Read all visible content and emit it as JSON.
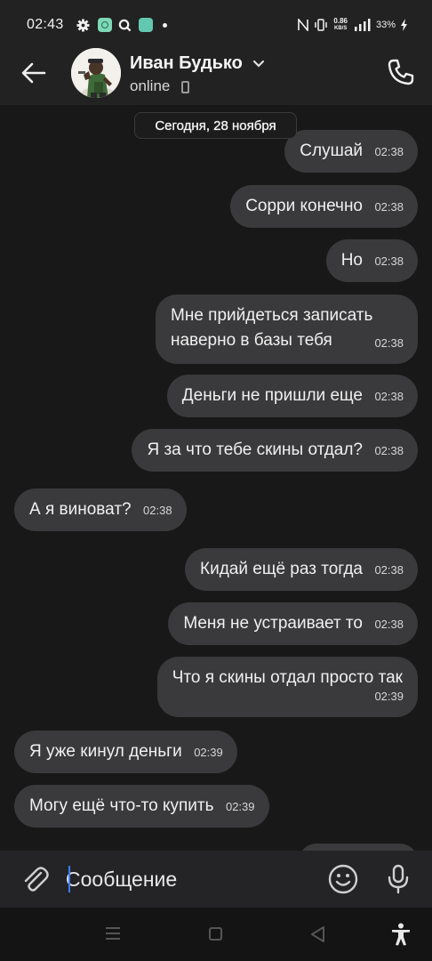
{
  "status_bar": {
    "time": "02:43",
    "speed_value": "0.86",
    "speed_unit": "KB/S",
    "battery": "33%"
  },
  "header": {
    "contact_name": "Иван Будько",
    "status": "online"
  },
  "chat": {
    "date_label": "Сегодня, 28 ноября",
    "messages": [
      {
        "dir": "out",
        "text": "Слушай",
        "time": "02:38"
      },
      {
        "dir": "out",
        "text": "Сорри конечно",
        "time": "02:38"
      },
      {
        "dir": "out",
        "text": "Но",
        "time": "02:38"
      },
      {
        "dir": "out",
        "text": "Мне прийдеться записать наверно в базы тебя",
        "time": "02:38"
      },
      {
        "dir": "out",
        "text": "Деньги не пришли еще",
        "time": "02:38"
      },
      {
        "dir": "out",
        "text": "Я за что тебе скины отдал?",
        "time": "02:38"
      },
      {
        "dir": "in",
        "text": "А я виноват?",
        "time": "02:38"
      },
      {
        "dir": "out",
        "text": "Кидай ещё раз тогда",
        "time": "02:38"
      },
      {
        "dir": "out",
        "text": "Меня не устраивает то",
        "time": "02:38"
      },
      {
        "dir": "out",
        "text": "Что я скины отдал просто так",
        "time": "02:39"
      },
      {
        "dir": "in",
        "text": "Я уже кинул деньги",
        "time": "02:39"
      },
      {
        "dir": "in",
        "text": "Могу ещё что-то купить",
        "time": "02:39"
      }
    ]
  },
  "composer": {
    "placeholder": "Сообщение"
  },
  "icons": {
    "back": "arrow-left-icon",
    "call": "phone-icon",
    "attach": "paperclip-icon",
    "emoji": "smiley-icon",
    "mic": "microphone-icon"
  },
  "colors": {
    "background": "#181818",
    "header": "#222222",
    "bubble": "#3a3a3c",
    "caret": "#3b7cff"
  }
}
